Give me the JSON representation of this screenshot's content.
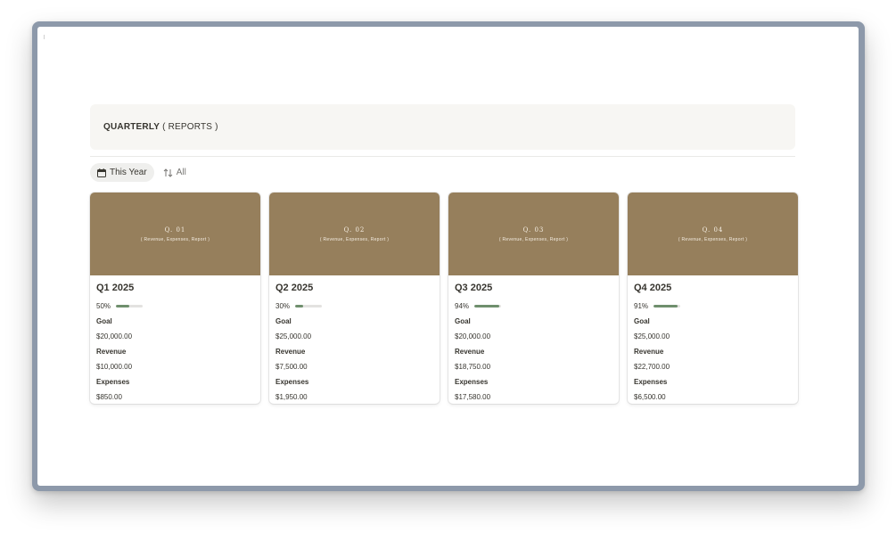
{
  "header": {
    "title_strong": "QUARTERLY",
    "title_rest": " ( REPORTS )"
  },
  "views": {
    "active": {
      "label": "This Year",
      "icon": "calendar-icon"
    },
    "secondary": {
      "label": "All",
      "icon": "sort-icon"
    }
  },
  "labels": {
    "goal": "Goal",
    "revenue": "Revenue",
    "expenses": "Expenses"
  },
  "colors": {
    "cover": "#967f5c",
    "progress": "#6f8f6d",
    "track": "#e3e2e0"
  },
  "cards": [
    {
      "cover_title": "Q. 01",
      "cover_subtitle": "( Revenue, Expenses, Report )",
      "title": "Q1 2025",
      "progress_label": "50%",
      "progress": 50,
      "goal": "$20,000.00",
      "revenue": "$10,000.00",
      "expenses": "$850.00"
    },
    {
      "cover_title": "Q. 02",
      "cover_subtitle": "( Revenue, Expenses, Report )",
      "title": "Q2 2025",
      "progress_label": "30%",
      "progress": 30,
      "goal": "$25,000.00",
      "revenue": "$7,500.00",
      "expenses": "$1,950.00"
    },
    {
      "cover_title": "Q. 03",
      "cover_subtitle": "( Revenue, Expenses, Report )",
      "title": "Q3 2025",
      "progress_label": "94%",
      "progress": 94,
      "goal": "$20,000.00",
      "revenue": "$18,750.00",
      "expenses": "$17,580.00"
    },
    {
      "cover_title": "Q. 04",
      "cover_subtitle": "( Revenue, Expenses, Report )",
      "title": "Q4 2025",
      "progress_label": "91%",
      "progress": 91,
      "goal": "$25,000.00",
      "revenue": "$22,700.00",
      "expenses": "$6,500.00"
    }
  ]
}
